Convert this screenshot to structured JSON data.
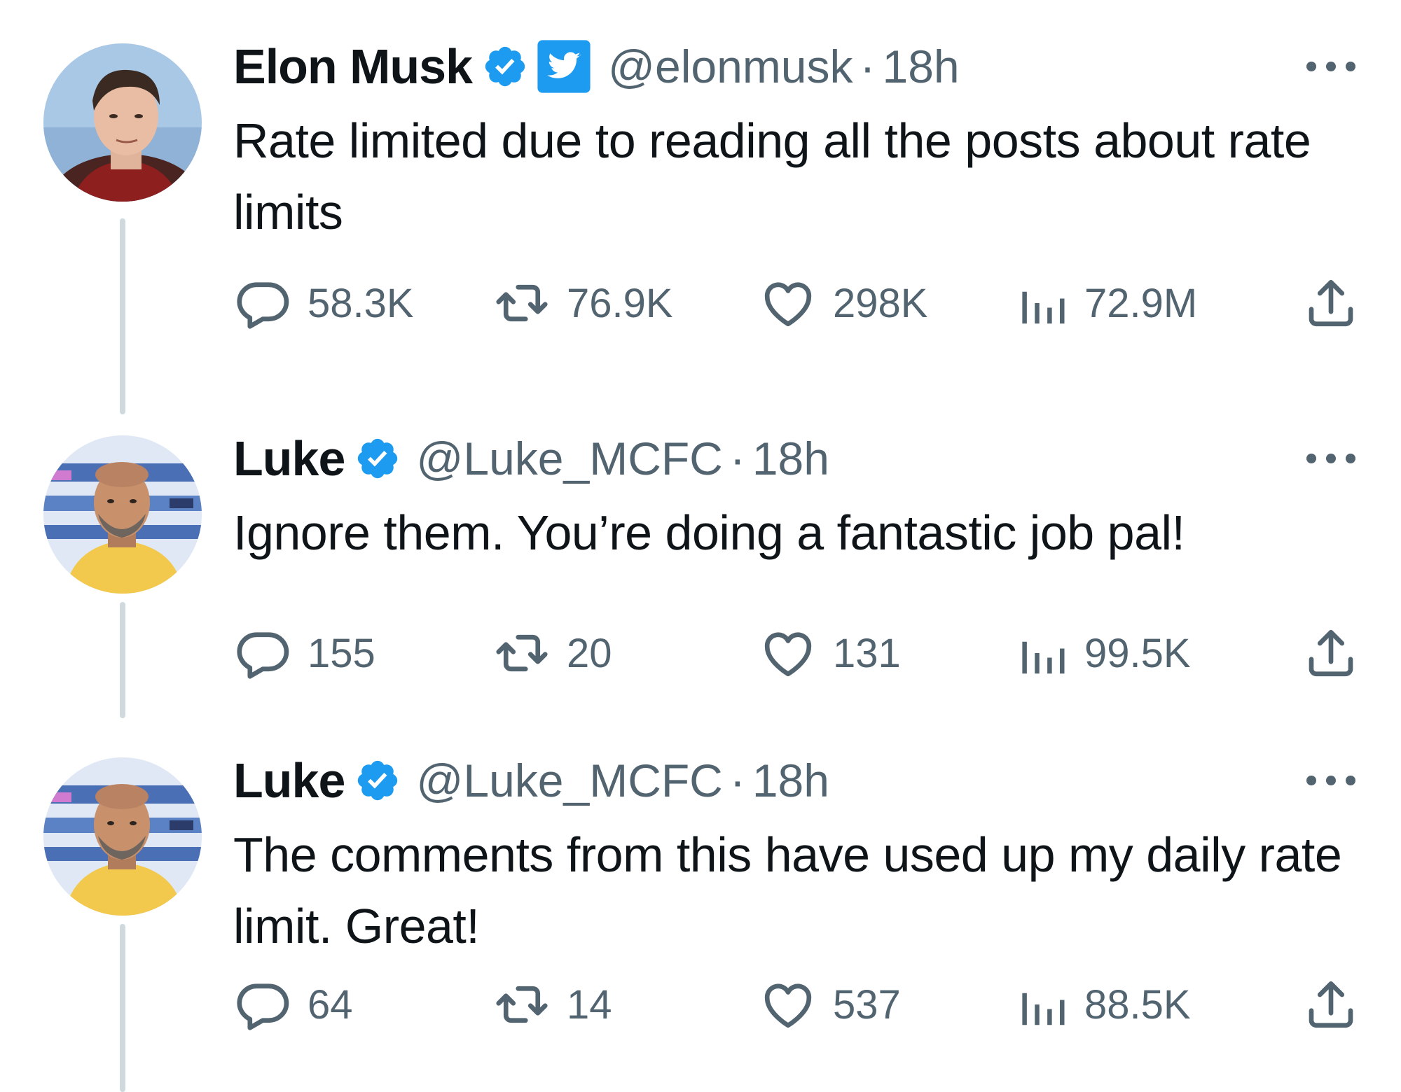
{
  "colors": {
    "verified_blue": "#1d9bf0",
    "secondary_text": "#536471",
    "primary_text": "#0f1419",
    "thread_line": "#cfd9de"
  },
  "tweets": [
    {
      "display_name": "Elon Musk",
      "verified": true,
      "affiliate_badge": "twitter-bird-badge",
      "handle": "@elonmusk",
      "dot": "·",
      "time": "18h",
      "text": "Rate limited due to reading all the posts about rate limits",
      "stats": {
        "replies": "58.3K",
        "retweets": "76.9K",
        "likes": "298K",
        "views": "72.9M"
      }
    },
    {
      "display_name": "Luke",
      "verified": true,
      "handle": "@Luke_MCFC",
      "dot": "·",
      "time": "18h",
      "text": "Ignore them. You’re doing a fantastic job pal!",
      "stats": {
        "replies": "155",
        "retweets": "20",
        "likes": "131",
        "views": "99.5K"
      }
    },
    {
      "display_name": "Luke",
      "verified": true,
      "handle": "@Luke_MCFC",
      "dot": "·",
      "time": "18h",
      "text": "The comments from this have used up my daily rate limit. Great!",
      "stats": {
        "replies": "64",
        "retweets": "14",
        "likes": "537",
        "views": "88.5K"
      }
    }
  ]
}
